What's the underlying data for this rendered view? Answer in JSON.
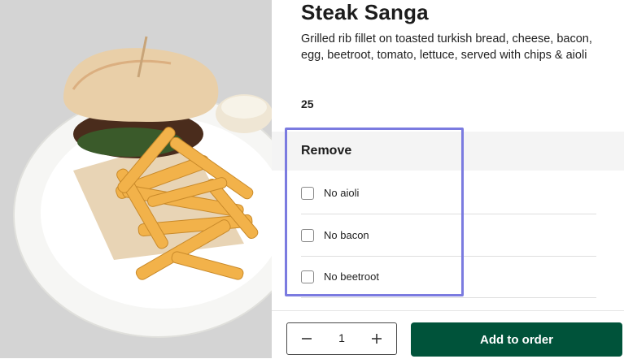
{
  "item": {
    "title": "Steak Sanga",
    "description": "Grilled rib fillet on toasted turkish bread, cheese, bacon, egg, beetroot, tomato, lettuce, served with chips & aioli",
    "price": "25"
  },
  "remove_section": {
    "heading": "Remove",
    "options": [
      {
        "label": "No aioli",
        "checked": false
      },
      {
        "label": "No bacon",
        "checked": false
      },
      {
        "label": "No beetroot",
        "checked": false
      }
    ]
  },
  "footer": {
    "quantity": "1",
    "minus_icon": "minus-icon",
    "plus_icon": "plus-icon",
    "add_label": "Add to order"
  },
  "colors": {
    "accent": "#00533a",
    "highlight": "#7b7be0",
    "section_bg": "#f4f4f4"
  }
}
